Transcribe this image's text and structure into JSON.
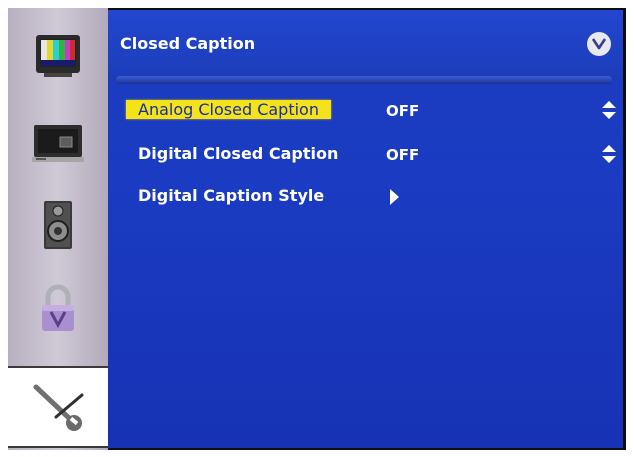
{
  "menu": {
    "title": "Closed Caption",
    "rows": [
      {
        "label": "Analog Closed Caption",
        "value": "OFF",
        "control": "up-down-icon"
      },
      {
        "label": "Digital Closed Caption",
        "value": "OFF",
        "control": "up-down-icon"
      },
      {
        "label": "Digital Caption Style",
        "control": "arrow-right-icon"
      }
    ]
  },
  "sidebar": {
    "items": [
      {
        "icon": "color-bars-tv-icon"
      },
      {
        "icon": "monitor-icon"
      },
      {
        "icon": "speaker-icon"
      },
      {
        "icon": "padlock-icon"
      },
      {
        "icon": "wrench-icon",
        "active": true
      }
    ]
  },
  "colors": {
    "menu_bg": "#1a3bc2",
    "highlight": "#f4e21a",
    "sidebar_bg": "#c8c0cf"
  }
}
